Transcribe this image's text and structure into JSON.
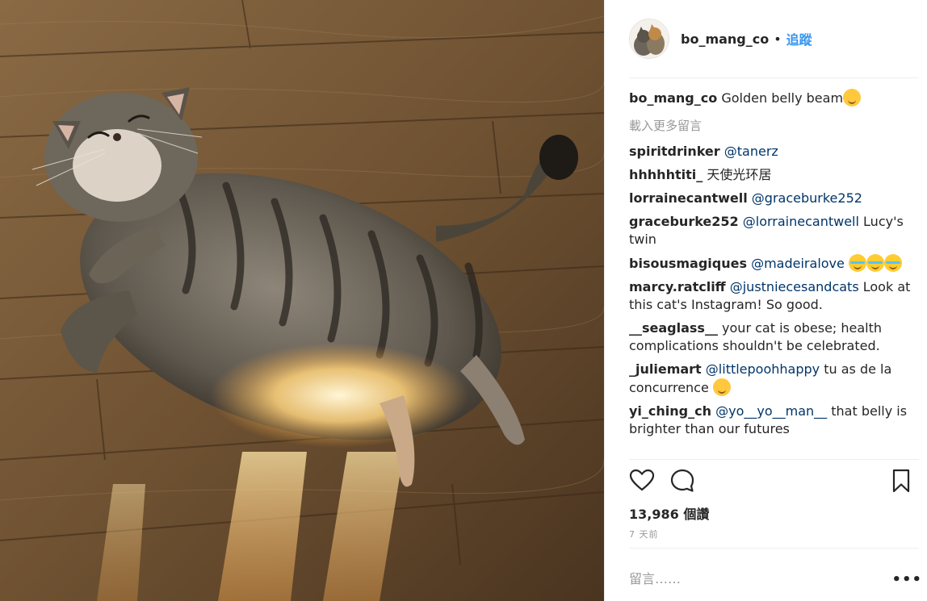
{
  "post": {
    "owner": "bo_mang_co",
    "separator": "•",
    "follow_label": "追蹤",
    "caption": {
      "user": "bo_mang_co",
      "text": "Golden belly beam",
      "emoji": "kissing-face-emoji"
    },
    "load_more_label": "載入更多留言"
  },
  "comments": [
    {
      "user": "spiritdrinker",
      "mention": "@tanerz",
      "text": ""
    },
    {
      "user": "hhhhhtiti_",
      "mention": "",
      "text": "天使光环居"
    },
    {
      "user": "lorrainecantwell",
      "mention": "@graceburke252",
      "text": ""
    },
    {
      "user": "graceburke252",
      "mention": "@lorrainecantwell",
      "text": "Lucy's twin"
    },
    {
      "user": "bisousmagiques",
      "mention": "@madeiralove",
      "text": "",
      "emoji": "tears-of-joy-emoji x3"
    },
    {
      "user": "marcy.ratcliff",
      "mention": "@justniecesandcats",
      "text": "Look at this cat's Instagram! So good."
    },
    {
      "user": "__seaglass__",
      "mention": "",
      "text": "your cat is obese; health complications shouldn't be celebrated."
    },
    {
      "user": "_juliemart",
      "mention": "@littlepoohhappy",
      "text": "tu as de la concurrence",
      "emoji": "smirking-face-emoji"
    },
    {
      "user": "yi_ching_ch",
      "mention": "@yo__yo__man__",
      "text": "that belly is brighter than our futures"
    }
  ],
  "actions": {
    "like_icon": "heart-icon",
    "comment_icon": "speech-bubble-icon",
    "save_icon": "bookmark-icon"
  },
  "likes_count": "13,986 個讚",
  "time_ago": "7 天前",
  "add_comment_placeholder": "留言……",
  "options_label": "•••",
  "colors": {
    "link": "#3897f0",
    "mention": "#003569",
    "muted": "#999999",
    "text": "#262626"
  }
}
